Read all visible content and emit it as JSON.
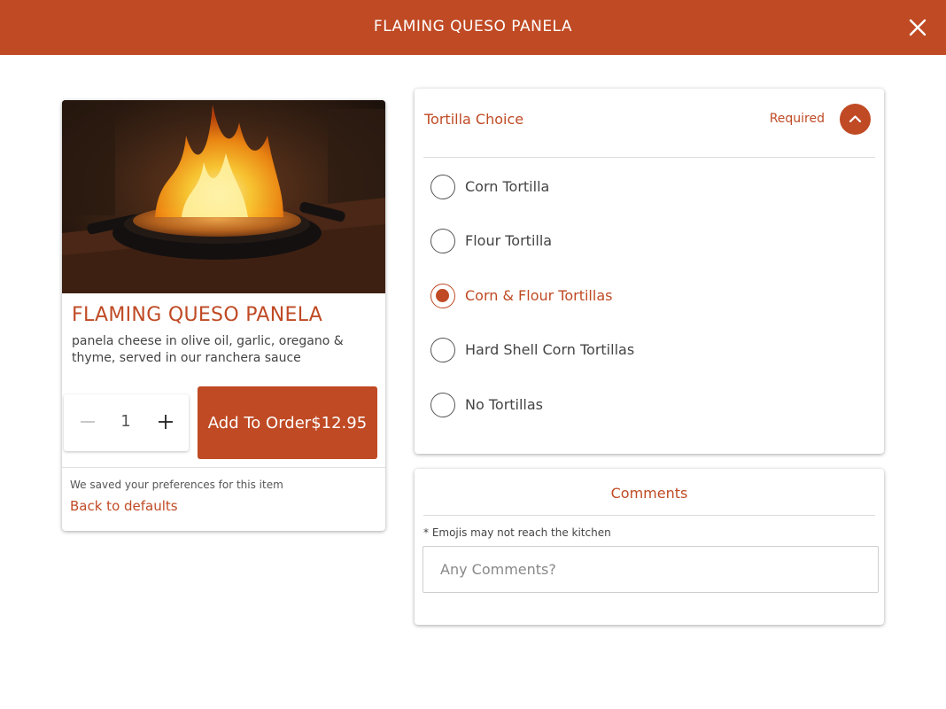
{
  "header": {
    "title": "FLAMING QUESO PANELA",
    "close_icon": "close-icon"
  },
  "item": {
    "name": "FLAMING QUESO PANELA",
    "description": "panela cheese in olive oil, garlic, oregano & thyme, served in our ranchera sauce",
    "quantity": "1",
    "minus_icon": "minus-icon",
    "plus_icon": "plus-icon",
    "add_label": "Add To Order",
    "price": "$12.95",
    "pref_note": "We saved your preferences for this item",
    "back_link": "Back to defaults"
  },
  "tortilla": {
    "title": "Tortilla Choice",
    "required": "Required",
    "collapse_icon": "chevron-up-icon",
    "options": [
      {
        "label": "Corn Tortilla",
        "selected": false
      },
      {
        "label": "Flour Tortilla",
        "selected": false
      },
      {
        "label": "Corn & Flour Tortillas",
        "selected": true
      },
      {
        "label": "Hard Shell Corn Tortillas",
        "selected": false
      },
      {
        "label": "No Tortillas",
        "selected": false
      }
    ]
  },
  "comments": {
    "title": "Comments",
    "note": "* Emojis may not reach the kitchen",
    "placeholder": "Any Comments?",
    "value": ""
  },
  "colors": {
    "accent": "#bf4a24",
    "background": "#ffffff"
  }
}
